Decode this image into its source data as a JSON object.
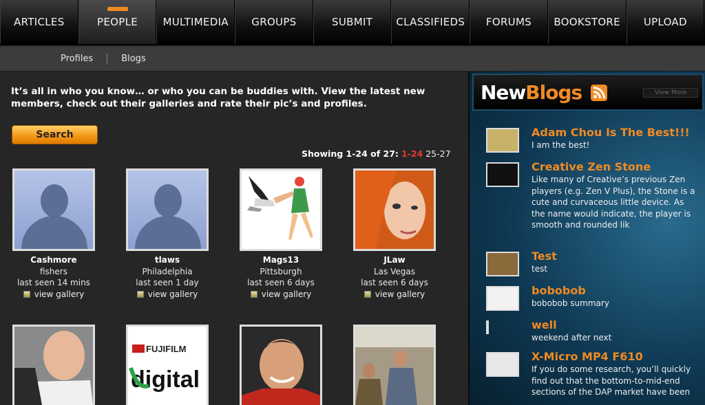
{
  "top_nav": {
    "tabs": [
      {
        "label": "ARTICLES"
      },
      {
        "label": "PEOPLE"
      },
      {
        "label": "MULTIMEDIA"
      },
      {
        "label": "GROUPS"
      },
      {
        "label": "SUBMIT"
      },
      {
        "label": "CLASSIFIEDS"
      },
      {
        "label": "FORUMS"
      },
      {
        "label": "BOOKSTORE"
      },
      {
        "label": "UPLOAD"
      }
    ],
    "active": "PEOPLE"
  },
  "sub_nav": {
    "items": [
      {
        "label": "Profiles"
      },
      {
        "label": "Blogs"
      }
    ]
  },
  "main": {
    "intro": "It’s all in who you know… or who you can be buddies with. View the latest new members, check out their galleries and rate their pic’s and profiles.",
    "search_label": "Search",
    "showing_label": "Showing 1-24 of 27:",
    "current_page": "1-24",
    "next_page": "25-27",
    "gallery_label": "view gallery",
    "members": [
      {
        "name": "Cashmore",
        "city": "fishers",
        "seen": "last seen 14 mins"
      },
      {
        "name": "tlaws",
        "city": "Philadelphia",
        "seen": "last seen 1 day"
      },
      {
        "name": "Mags13",
        "city": "Pittsburgh",
        "seen": "last seen 6 days"
      },
      {
        "name": "JLaw",
        "city": "Las Vegas",
        "seen": "last seen 6 days"
      }
    ],
    "second_row_logo": {
      "brand": "FUJIFILM",
      "word": "digital"
    }
  },
  "sidebar": {
    "title_part1": "New",
    "title_part2": "Blogs",
    "view_more": "View More",
    "blogs": [
      {
        "title": "Adam Chou Is The Best!!!",
        "summary": "I am the best!"
      },
      {
        "title": "Creative Zen Stone",
        "summary": "Like many of Creative’s previous Zen players (e.g. Zen V Plus), the Stone is a cute and curvaceous little device. As the name would indicate, the player is smooth and rounded lik"
      },
      {
        "title": "Test",
        "summary": "test"
      },
      {
        "title": "bobobob",
        "summary": "bobobob summary"
      },
      {
        "title": "well",
        "summary": "weekend after next"
      },
      {
        "title": "X-Micro MP4 F610",
        "summary": "If you do some research, you’ll quickly find out that the bottom-to-mid-end sections of the DAP market have been"
      }
    ]
  },
  "colors": {
    "accent": "#f08a24",
    "current_page": "#e23a2b"
  }
}
